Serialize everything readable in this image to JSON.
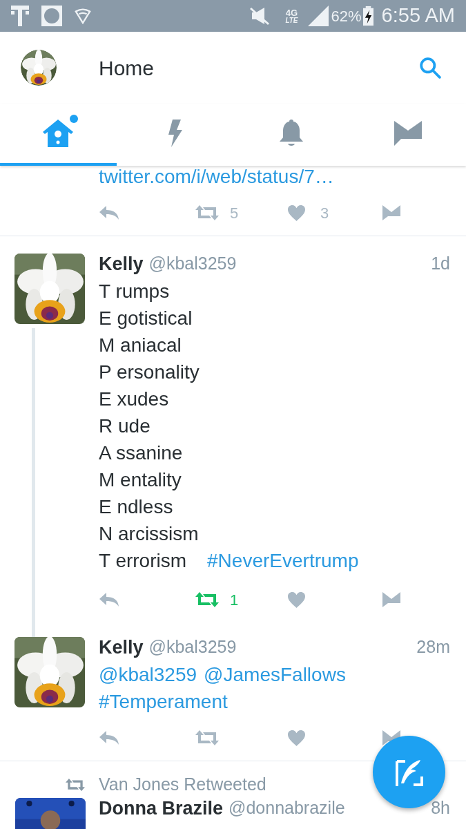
{
  "status_bar": {
    "network": "4G",
    "network_sub": "LTE",
    "battery": "62%",
    "time": "6:55 AM"
  },
  "header": {
    "title": "Home"
  },
  "tabs": [
    {
      "kind": "home",
      "selected": true,
      "unread": true
    },
    {
      "kind": "moments",
      "selected": false,
      "unread": false
    },
    {
      "kind": "notifications",
      "selected": false,
      "unread": false
    },
    {
      "kind": "messages",
      "selected": false,
      "unread": false
    }
  ],
  "feed": [
    {
      "kind": "partial",
      "lines": [
        [
          {
            "kind": "link",
            "text": "twitter.com/i/web/status/7…"
          }
        ]
      ],
      "actions": {
        "retweets": "5",
        "likes": "3",
        "retweeted": false
      }
    },
    {
      "kind": "tweet",
      "name": "Kelly",
      "handle": "@kbal3259",
      "time": "1d",
      "thread_continues": true,
      "lines": [
        [
          {
            "kind": "text",
            "text": "T rumps"
          }
        ],
        [
          {
            "kind": "text",
            "text": "E gotistical"
          }
        ],
        [
          {
            "kind": "text",
            "text": "M aniacal"
          }
        ],
        [
          {
            "kind": "text",
            "text": "P ersonality"
          }
        ],
        [
          {
            "kind": "text",
            "text": "E xudes"
          }
        ],
        [
          {
            "kind": "text",
            "text": "R ude"
          }
        ],
        [
          {
            "kind": "text",
            "text": "A ssanine"
          }
        ],
        [
          {
            "kind": "text",
            "text": "M entality"
          }
        ],
        [
          {
            "kind": "text",
            "text": "E ndless"
          }
        ],
        [
          {
            "kind": "text",
            "text": "N arcissism"
          }
        ],
        [
          {
            "kind": "text",
            "text": "T errorism"
          },
          {
            "kind": "link",
            "text": "#NeverEvertrump"
          }
        ]
      ],
      "actions": {
        "retweets": "1",
        "retweeted": true
      }
    },
    {
      "kind": "tweet",
      "name": "Kelly",
      "handle": "@kbal3259",
      "time": "28m",
      "thread_continues": false,
      "lines": [
        [
          {
            "kind": "link",
            "text": "@kbal3259"
          },
          {
            "kind": "link",
            "text": "@JamesFallows"
          }
        ],
        [
          {
            "kind": "link",
            "text": "#Temperament"
          }
        ]
      ],
      "actions": {
        "retweeted": false
      }
    },
    {
      "kind": "retweet_banner",
      "text": "Van Jones Retweeted"
    },
    {
      "kind": "cut",
      "name": "Donna Brazile",
      "handle": "@donnabrazile",
      "time": "8h"
    }
  ]
}
